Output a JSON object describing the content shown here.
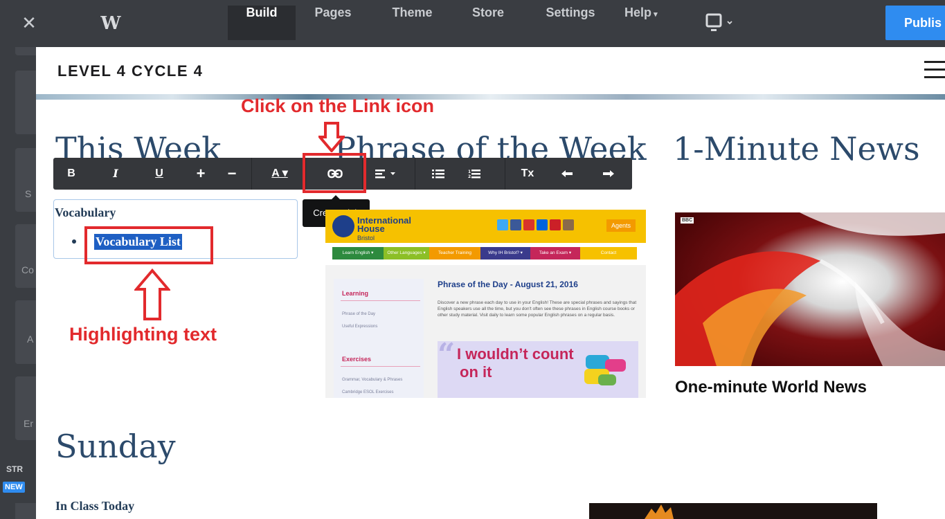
{
  "topbar": {
    "close_icon": "close-icon",
    "logo_icon": "weebly-logo-icon",
    "tabs": [
      {
        "label": "Build",
        "active": true
      },
      {
        "label": "Pages",
        "active": false
      },
      {
        "label": "Theme",
        "active": false
      },
      {
        "label": "Store",
        "active": false
      },
      {
        "label": "Settings",
        "active": false
      },
      {
        "label": "Help",
        "active": false
      }
    ],
    "device_icon": "desktop-device-icon",
    "publish_label": "Publis",
    "colors": {
      "bar": "#3a3d42",
      "publish": "#2f8cf0"
    }
  },
  "sidebar": {
    "tile_fragments": [
      "S",
      "Co",
      "A",
      "Er"
    ],
    "section_label": "STR",
    "badge": "NEW"
  },
  "site": {
    "title": "LEVEL 4 CYCLE 4",
    "menu_icon": "hamburger-menu-icon"
  },
  "main": {
    "this_week": {
      "heading": "This Week",
      "vocab_title": "Vocabulary",
      "vocab_item": "Vocabulary List"
    },
    "phrase": {
      "heading": "Phrase of the Week",
      "image": {
        "brand_line1": "International",
        "brand_line2": "House",
        "brand_line3": "Bristol",
        "agents_label": "Agents",
        "nav": [
          "Learn English ▾",
          "Other Languages ▾",
          "Teacher Training",
          "Why IH Bristol? ▾",
          "Take an Exam ▾",
          "Contact"
        ],
        "learning_heading": "Learning",
        "learning_links": [
          "Phrase of the Day",
          "Useful Expressions"
        ],
        "exercises_heading": "Exercises",
        "exercise_links": [
          "Grammar, Vocabulary & Phrases",
          "Cambridge ESOL Exercises"
        ],
        "article_title": "Phrase of the Day - August 21, 2016",
        "article_text": "Discover a new phrase each day to use in your English! These are special phrases and sayings that English speakers use all the time, but you don't often see these phrases in English course books or other study material. Visit daily to learn some popular English phrases on a regular basis.",
        "quote_line1": "I wouldn’t count",
        "quote_line2": "on it"
      }
    },
    "news": {
      "heading": "1-Minute News",
      "bbc_label": "BBC",
      "caption": "One-minute World News"
    },
    "sunday": {
      "heading": "Sunday",
      "subheading": "In Class Today"
    }
  },
  "toolbar": {
    "buttons": [
      {
        "name": "bold-button",
        "label": "B"
      },
      {
        "name": "italic-button",
        "label": "I"
      },
      {
        "name": "underline-button",
        "label": "U"
      },
      {
        "name": "increase-size-button",
        "label": "+"
      },
      {
        "name": "decrease-size-button",
        "label": "−"
      },
      {
        "name": "font-color-button",
        "label": "A ▾"
      },
      {
        "name": "create-link-button",
        "icon": "link-icon"
      },
      {
        "name": "align-button",
        "icon": "align-left-icon"
      },
      {
        "name": "bulleted-list-button",
        "icon": "bulleted-list-icon"
      },
      {
        "name": "numbered-list-button",
        "icon": "numbered-list-icon"
      },
      {
        "name": "clear-format-button",
        "label": "Tx"
      },
      {
        "name": "undo-button",
        "icon": "undo-icon"
      },
      {
        "name": "redo-button",
        "icon": "redo-icon"
      }
    ],
    "tooltip": "Create Link"
  },
  "annotations": {
    "click_link": "Click on the Link icon",
    "highlighting": "Highlighting text",
    "color": "#e22a2d"
  }
}
